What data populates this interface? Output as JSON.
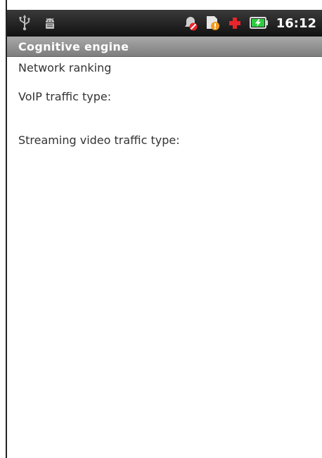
{
  "status_bar": {
    "time": "16:12",
    "left_icons": [
      "usb-icon",
      "android-debug-icon"
    ],
    "right_icons": [
      "notification-muted-icon",
      "warning-icon",
      "health-plus-icon",
      "battery-charging-icon"
    ]
  },
  "app": {
    "title": "Cognitive engine"
  },
  "main": {
    "items": [
      {
        "label": "Network ranking"
      },
      {
        "label": "VoIP traffic type:"
      },
      {
        "label": "Streaming video traffic type:"
      }
    ]
  },
  "colors": {
    "status_bar_bg": "#1a1a1a",
    "title_bar_bg": "#8f8f8f",
    "text": "#333333",
    "accent_red": "#e8262b",
    "accent_orange": "#f39a1e",
    "battery_green": "#2ecc40"
  }
}
